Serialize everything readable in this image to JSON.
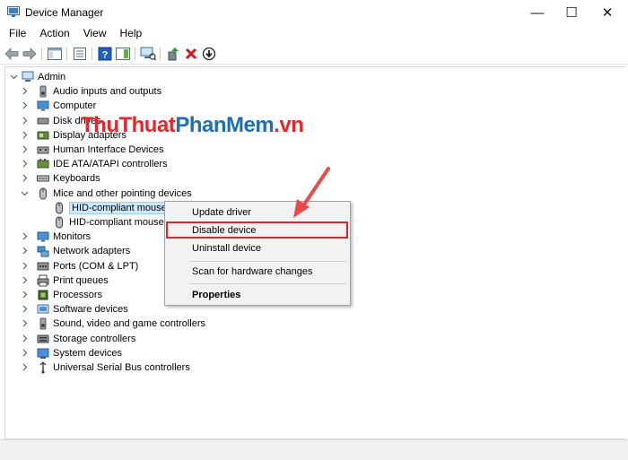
{
  "window": {
    "title": "Device Manager",
    "controls": {
      "minimize": "—",
      "maximize": "☐",
      "close": "✕"
    }
  },
  "menu": [
    "File",
    "Action",
    "View",
    "Help"
  ],
  "tree": {
    "root": "Admin",
    "categories": [
      {
        "label": "Audio inputs and outputs",
        "icon": "speaker-icon",
        "expanded": false
      },
      {
        "label": "Computer",
        "icon": "monitor-icon",
        "expanded": false
      },
      {
        "label": "Disk drives",
        "icon": "disk-drive-icon",
        "expanded": false
      },
      {
        "label": "Display adapters",
        "icon": "display-adapter-icon",
        "expanded": false
      },
      {
        "label": "Human Interface Devices",
        "icon": "hid-icon",
        "expanded": false
      },
      {
        "label": "IDE ATA/ATAPI controllers",
        "icon": "ide-controller-icon",
        "expanded": false
      },
      {
        "label": "Keyboards",
        "icon": "keyboard-icon",
        "expanded": false
      },
      {
        "label": "Mice and other pointing devices",
        "icon": "mouse-icon",
        "expanded": true,
        "children": [
          "HID-compliant mouse",
          "HID-compliant mouse"
        ]
      },
      {
        "label": "Monitors",
        "icon": "monitor-icon",
        "expanded": false
      },
      {
        "label": "Network adapters",
        "icon": "network-icon",
        "expanded": false
      },
      {
        "label": "Ports (COM & LPT)",
        "icon": "port-icon",
        "expanded": false
      },
      {
        "label": "Print queues",
        "icon": "printer-icon",
        "expanded": false
      },
      {
        "label": "Processors",
        "icon": "processor-icon",
        "expanded": false
      },
      {
        "label": "Software devices",
        "icon": "software-device-icon",
        "expanded": false
      },
      {
        "label": "Sound, video and game controllers",
        "icon": "speaker-icon",
        "expanded": false
      },
      {
        "label": "Storage controllers",
        "icon": "storage-icon",
        "expanded": false
      },
      {
        "label": "System devices",
        "icon": "system-icon",
        "expanded": false
      },
      {
        "label": "Universal Serial Bus controllers",
        "icon": "usb-icon",
        "expanded": false
      }
    ]
  },
  "context_menu": {
    "update_driver": "Update driver",
    "disable_device": "Disable device",
    "uninstall_device": "Uninstall device",
    "scan": "Scan for hardware changes",
    "properties": "Properties"
  },
  "watermark": {
    "part1": "ThuThuat",
    "part2": "PhanMem",
    "part3": ".vn"
  },
  "colors": {
    "highlight": "#e0262a",
    "selection": "#cce8ff",
    "accent": "#1e6fb7"
  }
}
